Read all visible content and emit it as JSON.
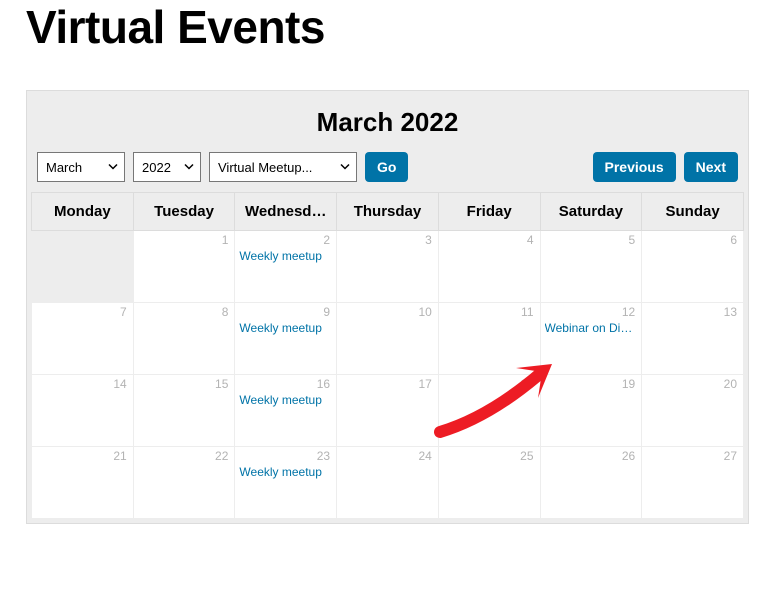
{
  "page": {
    "title": "Virtual Events"
  },
  "calendar": {
    "title": "March 2022",
    "month_select": "March",
    "year_select": "2022",
    "category_select": "Virtual Meetup...",
    "go_label": "Go",
    "prev_label": "Previous",
    "next_label": "Next",
    "day_headers": [
      "Monday",
      "Tuesday",
      "Wednesd…",
      "Thursday",
      "Friday",
      "Saturday",
      "Sunday"
    ],
    "weeks": [
      [
        {
          "num": "",
          "other": true
        },
        {
          "num": "1"
        },
        {
          "num": "2",
          "event": "Weekly meetup"
        },
        {
          "num": "3"
        },
        {
          "num": "4"
        },
        {
          "num": "5"
        },
        {
          "num": "6"
        }
      ],
      [
        {
          "num": "7"
        },
        {
          "num": "8"
        },
        {
          "num": "9",
          "event": "Weekly meetup"
        },
        {
          "num": "10"
        },
        {
          "num": "11"
        },
        {
          "num": "12",
          "event": "Webinar on Di…"
        },
        {
          "num": "13"
        }
      ],
      [
        {
          "num": "14"
        },
        {
          "num": "15"
        },
        {
          "num": "16",
          "event": "Weekly meetup"
        },
        {
          "num": "17"
        },
        {
          "num": "18"
        },
        {
          "num": "19"
        },
        {
          "num": "20"
        }
      ],
      [
        {
          "num": "21"
        },
        {
          "num": "22"
        },
        {
          "num": "23",
          "event": "Weekly meetup"
        },
        {
          "num": "24"
        },
        {
          "num": "25"
        },
        {
          "num": "26"
        },
        {
          "num": "27"
        }
      ]
    ]
  }
}
